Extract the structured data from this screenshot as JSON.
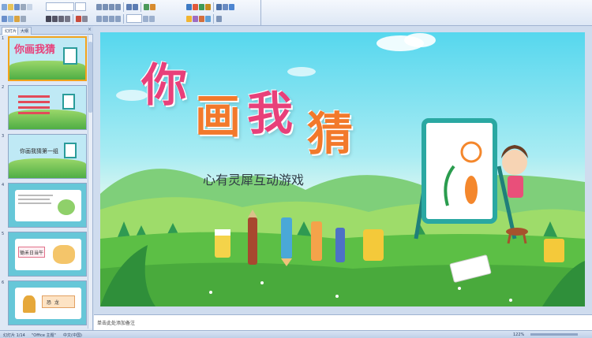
{
  "panel": {
    "tab_slides": "幻灯片",
    "tab_outline": "大纲",
    "close": "×"
  },
  "thumbnails": [
    {
      "num": "1",
      "title": "你画我猜",
      "selected": true
    },
    {
      "num": "2",
      "title": "",
      "selected": false
    },
    {
      "num": "3",
      "title": "你画我猜第一组",
      "selected": false
    },
    {
      "num": "4",
      "title": "",
      "selected": false
    },
    {
      "num": "5",
      "title": "锄禾日当午",
      "selected": false
    },
    {
      "num": "6",
      "title": "恐  龙",
      "selected": false
    }
  ],
  "slide": {
    "title_chars": [
      "你",
      "画",
      "我",
      "猜"
    ],
    "title_colors": [
      "#e8407a",
      "#f2792b",
      "#e8407a",
      "#f2792b"
    ],
    "subtitle": "心有灵犀互动游戏"
  },
  "notes": {
    "placeholder": "单击此处添加备注"
  },
  "status": {
    "slide": "幻灯片 1/14",
    "theme": "\"Office 主题\"",
    "lang": "中文(中国)",
    "zoom": "122%"
  }
}
